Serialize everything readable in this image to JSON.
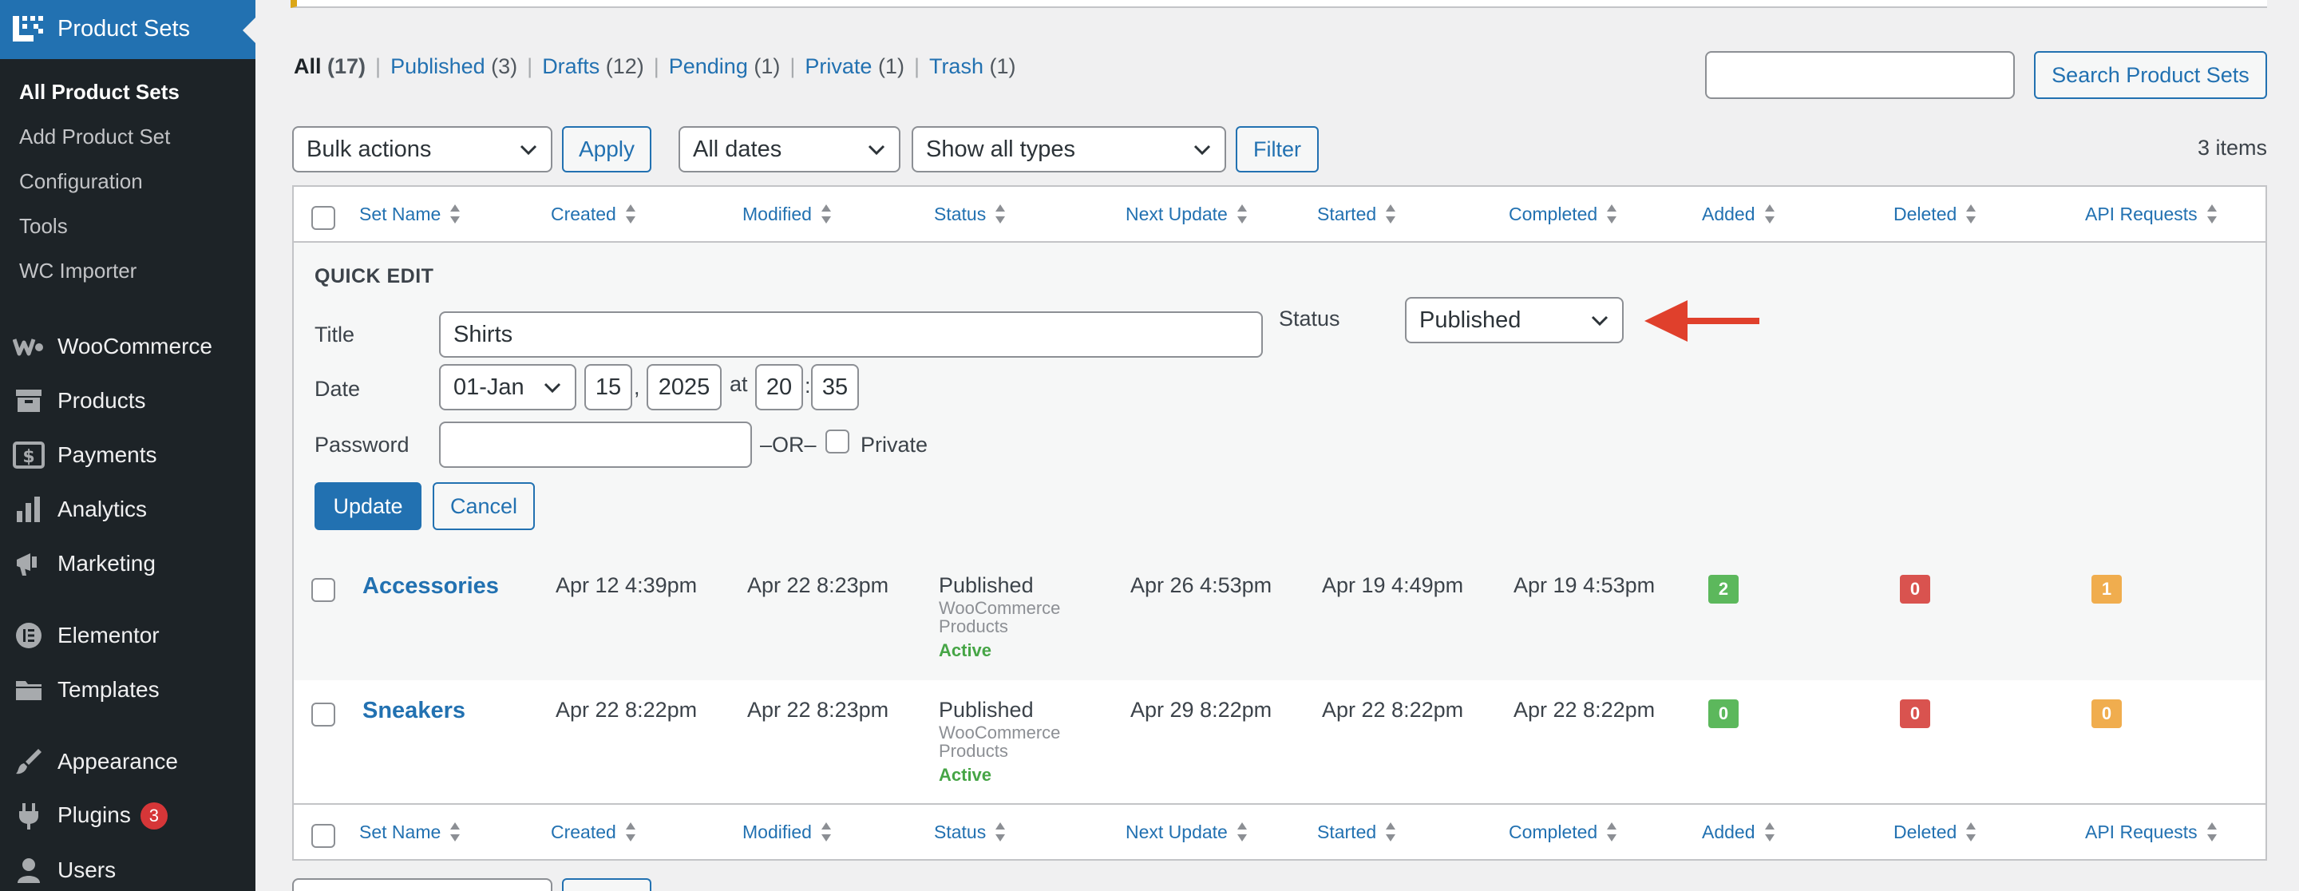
{
  "sidebar": {
    "current": {
      "label": "Product Sets",
      "icon": "product-sets-icon"
    },
    "submenu": [
      "All Product Sets",
      "Add Product Set",
      "Configuration",
      "Tools",
      "WC Importer"
    ],
    "menu": [
      {
        "label": "WooCommerce",
        "icon": "woocommerce-icon"
      },
      {
        "label": "Products",
        "icon": "archive-icon"
      },
      {
        "label": "Payments",
        "icon": "dollar-icon"
      },
      {
        "label": "Analytics",
        "icon": "bar-chart-icon"
      },
      {
        "label": "Marketing",
        "icon": "megaphone-icon"
      },
      {
        "label": "Elementor",
        "icon": "elementor-icon"
      },
      {
        "label": "Templates",
        "icon": "folder-icon"
      },
      {
        "label": "Appearance",
        "icon": "brush-icon"
      },
      {
        "label": "Plugins",
        "icon": "plug-icon",
        "badge": "3"
      },
      {
        "label": "Users",
        "icon": "user-icon"
      }
    ]
  },
  "views": [
    {
      "label": "All",
      "count": "(17)"
    },
    {
      "label": "Published",
      "count": "(3)"
    },
    {
      "label": "Drafts",
      "count": "(12)"
    },
    {
      "label": "Pending",
      "count": "(1)"
    },
    {
      "label": "Private",
      "count": "(1)"
    },
    {
      "label": "Trash",
      "count": "(1)"
    }
  ],
  "search": {
    "value": "",
    "button": "Search Product Sets"
  },
  "filters": {
    "bulk_actions": "Bulk actions",
    "apply": "Apply",
    "dates": "All dates",
    "types": "Show all types",
    "filter": "Filter",
    "items_count": "3 items"
  },
  "columns": [
    "Set Name",
    "Created",
    "Modified",
    "Status",
    "Next Update",
    "Started",
    "Completed",
    "Added",
    "Deleted",
    "API Requests"
  ],
  "quick_edit": {
    "heading": "QUICK EDIT",
    "title_label": "Title",
    "title_value": "Shirts",
    "status_label": "Status",
    "status_value": "Published",
    "date_label": "Date",
    "month": "01-Jan",
    "day": "15",
    "comma": ",",
    "year": "2025",
    "at": "at",
    "hour": "20",
    "colon": ":",
    "minute": "35",
    "password_label": "Password",
    "password_value": "",
    "or": "–OR–",
    "private_label": "Private",
    "update": "Update",
    "cancel": "Cancel"
  },
  "rows": [
    {
      "name": "Accessories",
      "created": "Apr 12 4:39pm",
      "modified": "Apr 22 8:23pm",
      "status": "Published",
      "status_sub1": "WooCommerce",
      "status_sub2": "Products",
      "status_active": "Active",
      "next_update": "Apr 26 4:53pm",
      "started": "Apr 19 4:49pm",
      "completed": "Apr 19 4:53pm",
      "added": "2",
      "deleted": "0",
      "api_requests": "1"
    },
    {
      "name": "Sneakers",
      "created": "Apr 22 8:22pm",
      "modified": "Apr 22 8:23pm",
      "status": "Published",
      "status_sub1": "WooCommerce",
      "status_sub2": "Products",
      "status_active": "Active",
      "next_update": "Apr 29 8:22pm",
      "started": "Apr 22 8:22pm",
      "completed": "Apr 22 8:22pm",
      "added": "0",
      "deleted": "0",
      "api_requests": "0"
    }
  ],
  "colors": {
    "accent": "#2271b1",
    "sidebar_bg": "#1d2327",
    "annotation_arrow": "#e0402c",
    "added_badge": "#5cb85c",
    "deleted_badge": "#d9534f",
    "api_badge": "#f0ad4e",
    "active_text": "#46a546"
  }
}
